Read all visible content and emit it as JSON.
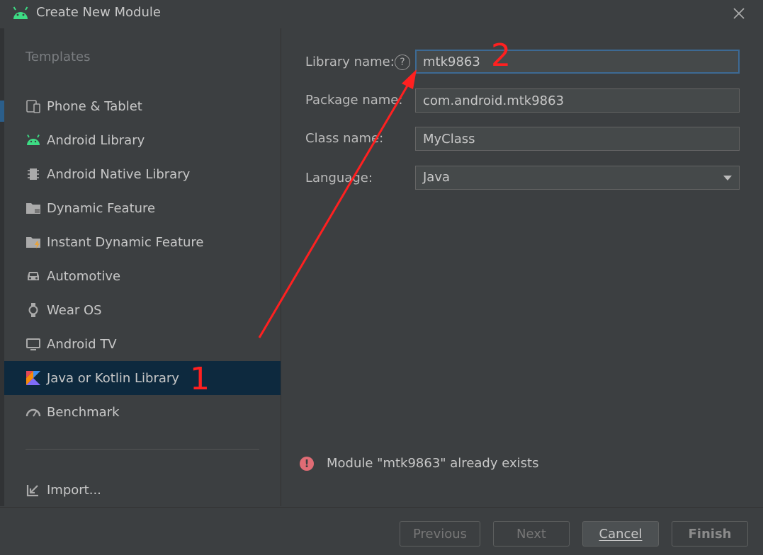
{
  "window": {
    "title": "Create New Module",
    "close_icon": "close-icon",
    "app_icon": "android-icon"
  },
  "sidebar": {
    "heading": "Templates",
    "items": [
      {
        "label": "Phone & Tablet",
        "icon": "phone-tablet-icon"
      },
      {
        "label": "Android Library",
        "icon": "android-icon"
      },
      {
        "label": "Android Native Library",
        "icon": "native-library-icon"
      },
      {
        "label": "Dynamic Feature",
        "icon": "folder-icon"
      },
      {
        "label": "Instant Dynamic Feature",
        "icon": "folder-bolt-icon"
      },
      {
        "label": "Automotive",
        "icon": "car-icon"
      },
      {
        "label": "Wear OS",
        "icon": "watch-icon"
      },
      {
        "label": "Android TV",
        "icon": "tv-icon"
      },
      {
        "label": "Java or Kotlin Library",
        "icon": "kotlin-icon",
        "selected": true
      },
      {
        "label": "Benchmark",
        "icon": "gauge-icon"
      }
    ],
    "import_label": "Import..."
  },
  "form": {
    "library_name_label": "Library name:",
    "library_name_value": "mtk9863",
    "package_name_label": "Package name:",
    "package_name_value": "com.android.mtk9863",
    "class_name_label": "Class name:",
    "class_name_value": "MyClass",
    "language_label": "Language:",
    "language_value": "Java",
    "help_glyph": "?"
  },
  "error": {
    "message": "Module \"mtk9863\" already exists",
    "glyph": "!"
  },
  "footer": {
    "previous": "Previous",
    "next": "Next",
    "cancel": "Cancel",
    "finish": "Finish"
  },
  "annotations": {
    "one": "1",
    "two": "2",
    "color": "#ff2020"
  },
  "colors": {
    "accent_selected": "#0d293e",
    "focus_border": "#3d6a94",
    "error": "#e06c75",
    "android_green": "#3ddc84"
  }
}
